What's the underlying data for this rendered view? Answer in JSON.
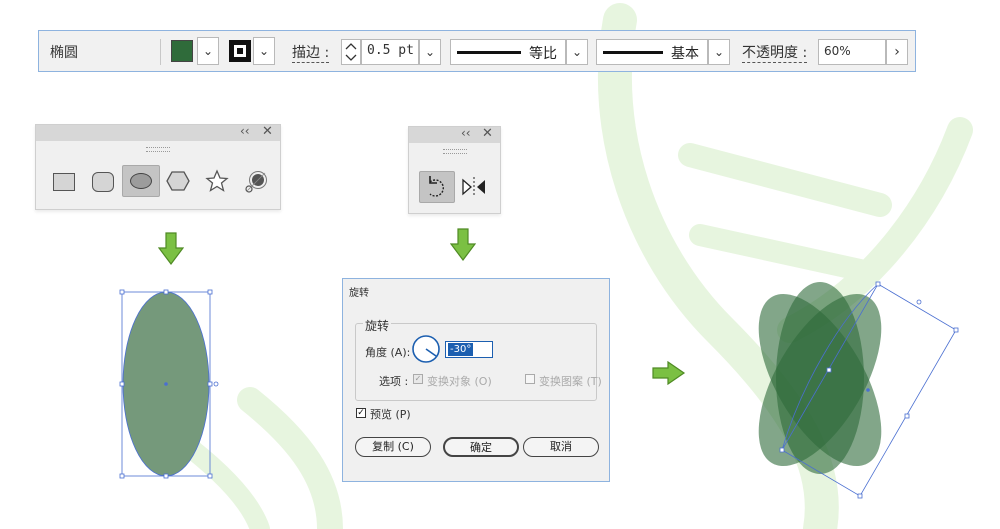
{
  "colors": {
    "fill": "#2f6b3a",
    "ellipse": "#75997b",
    "arrow": "#7bc043",
    "watermark": "#e7f5df",
    "accent_border": "#8eb3df",
    "focus": "#1c5fb0"
  },
  "control_bar": {
    "object_type": "椭圆",
    "stroke_label": "描边 :",
    "stroke_value": "0.5 pt",
    "profile_label": "等比",
    "brush_label": "基本",
    "opacity_label": "不透明度 :",
    "opacity_value": "60%",
    "more_icon": "chevron-right-icon"
  },
  "shape_panel": {
    "tools": [
      "rectangle-tool",
      "rounded-rectangle-tool",
      "ellipse-tool",
      "polygon-tool",
      "star-tool",
      "flare-tool"
    ],
    "selected": "ellipse-tool",
    "collapse_glyph": "‹‹",
    "close_glyph": "✕"
  },
  "transform_panel": {
    "tools": [
      "rotate-tool",
      "reflect-tool"
    ],
    "selected": "rotate-tool",
    "collapse_glyph": "‹‹",
    "close_glyph": "✕"
  },
  "dialog": {
    "title": "旋转",
    "group_title": "旋转",
    "angle_label": "角度 (A):",
    "angle_value": "-30°",
    "options_label": "选项 :",
    "transform_objects": "变换对象 (O)",
    "transform_patterns": "变换图案 (T)",
    "preview_label": "预览 (P)",
    "copy_button": "复制 (C)",
    "ok_button": "确定",
    "cancel_button": "取消"
  }
}
